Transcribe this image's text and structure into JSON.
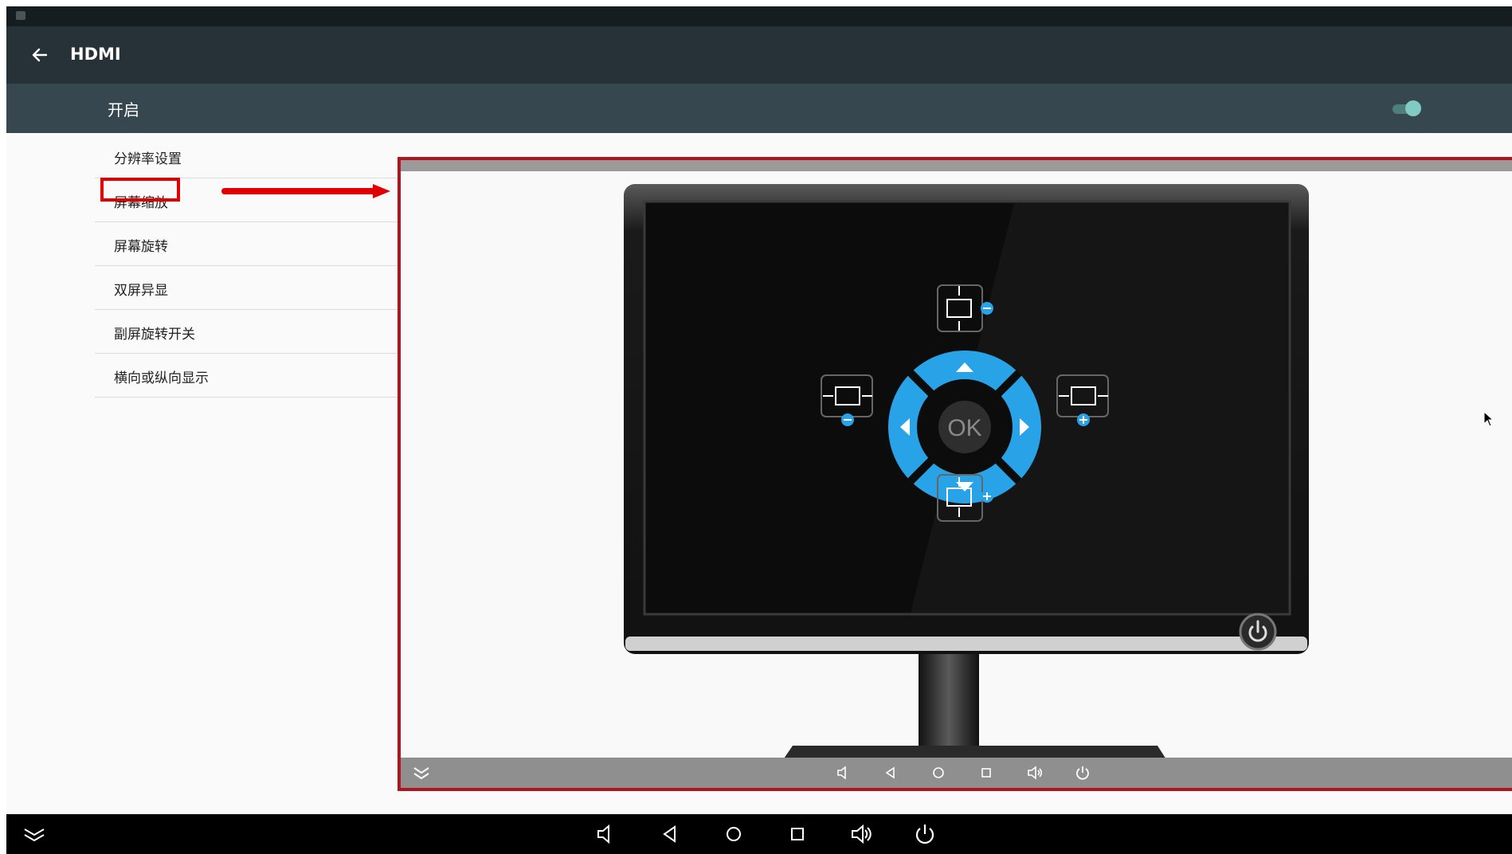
{
  "app": {
    "title": "HDMI",
    "back_icon": "arrow-left-icon"
  },
  "switch": {
    "label": "开启",
    "state": "on",
    "accent": "#80cbc4"
  },
  "menu": {
    "items": [
      {
        "label": "分辨率设置"
      },
      {
        "label": "屏幕缩放"
      },
      {
        "label": "屏幕旋转"
      },
      {
        "label": "双屏异显"
      },
      {
        "label": "副屏旋转开关"
      },
      {
        "label": "横向或纵向显示"
      }
    ]
  },
  "highlight_color": "#e10000",
  "preview": {
    "ok_label": "OK",
    "dpad_color": "#29a3e8",
    "controls": [
      "shrink-vertical-icon",
      "shrink-horizontal-icon",
      "expand-horizontal-icon",
      "expand-vertical-icon",
      "power-icon"
    ]
  },
  "navbar": {
    "icons": [
      "collapse-icon",
      "volume-down-icon",
      "back-icon",
      "home-icon",
      "recents-icon",
      "volume-up-icon",
      "power-icon"
    ]
  }
}
